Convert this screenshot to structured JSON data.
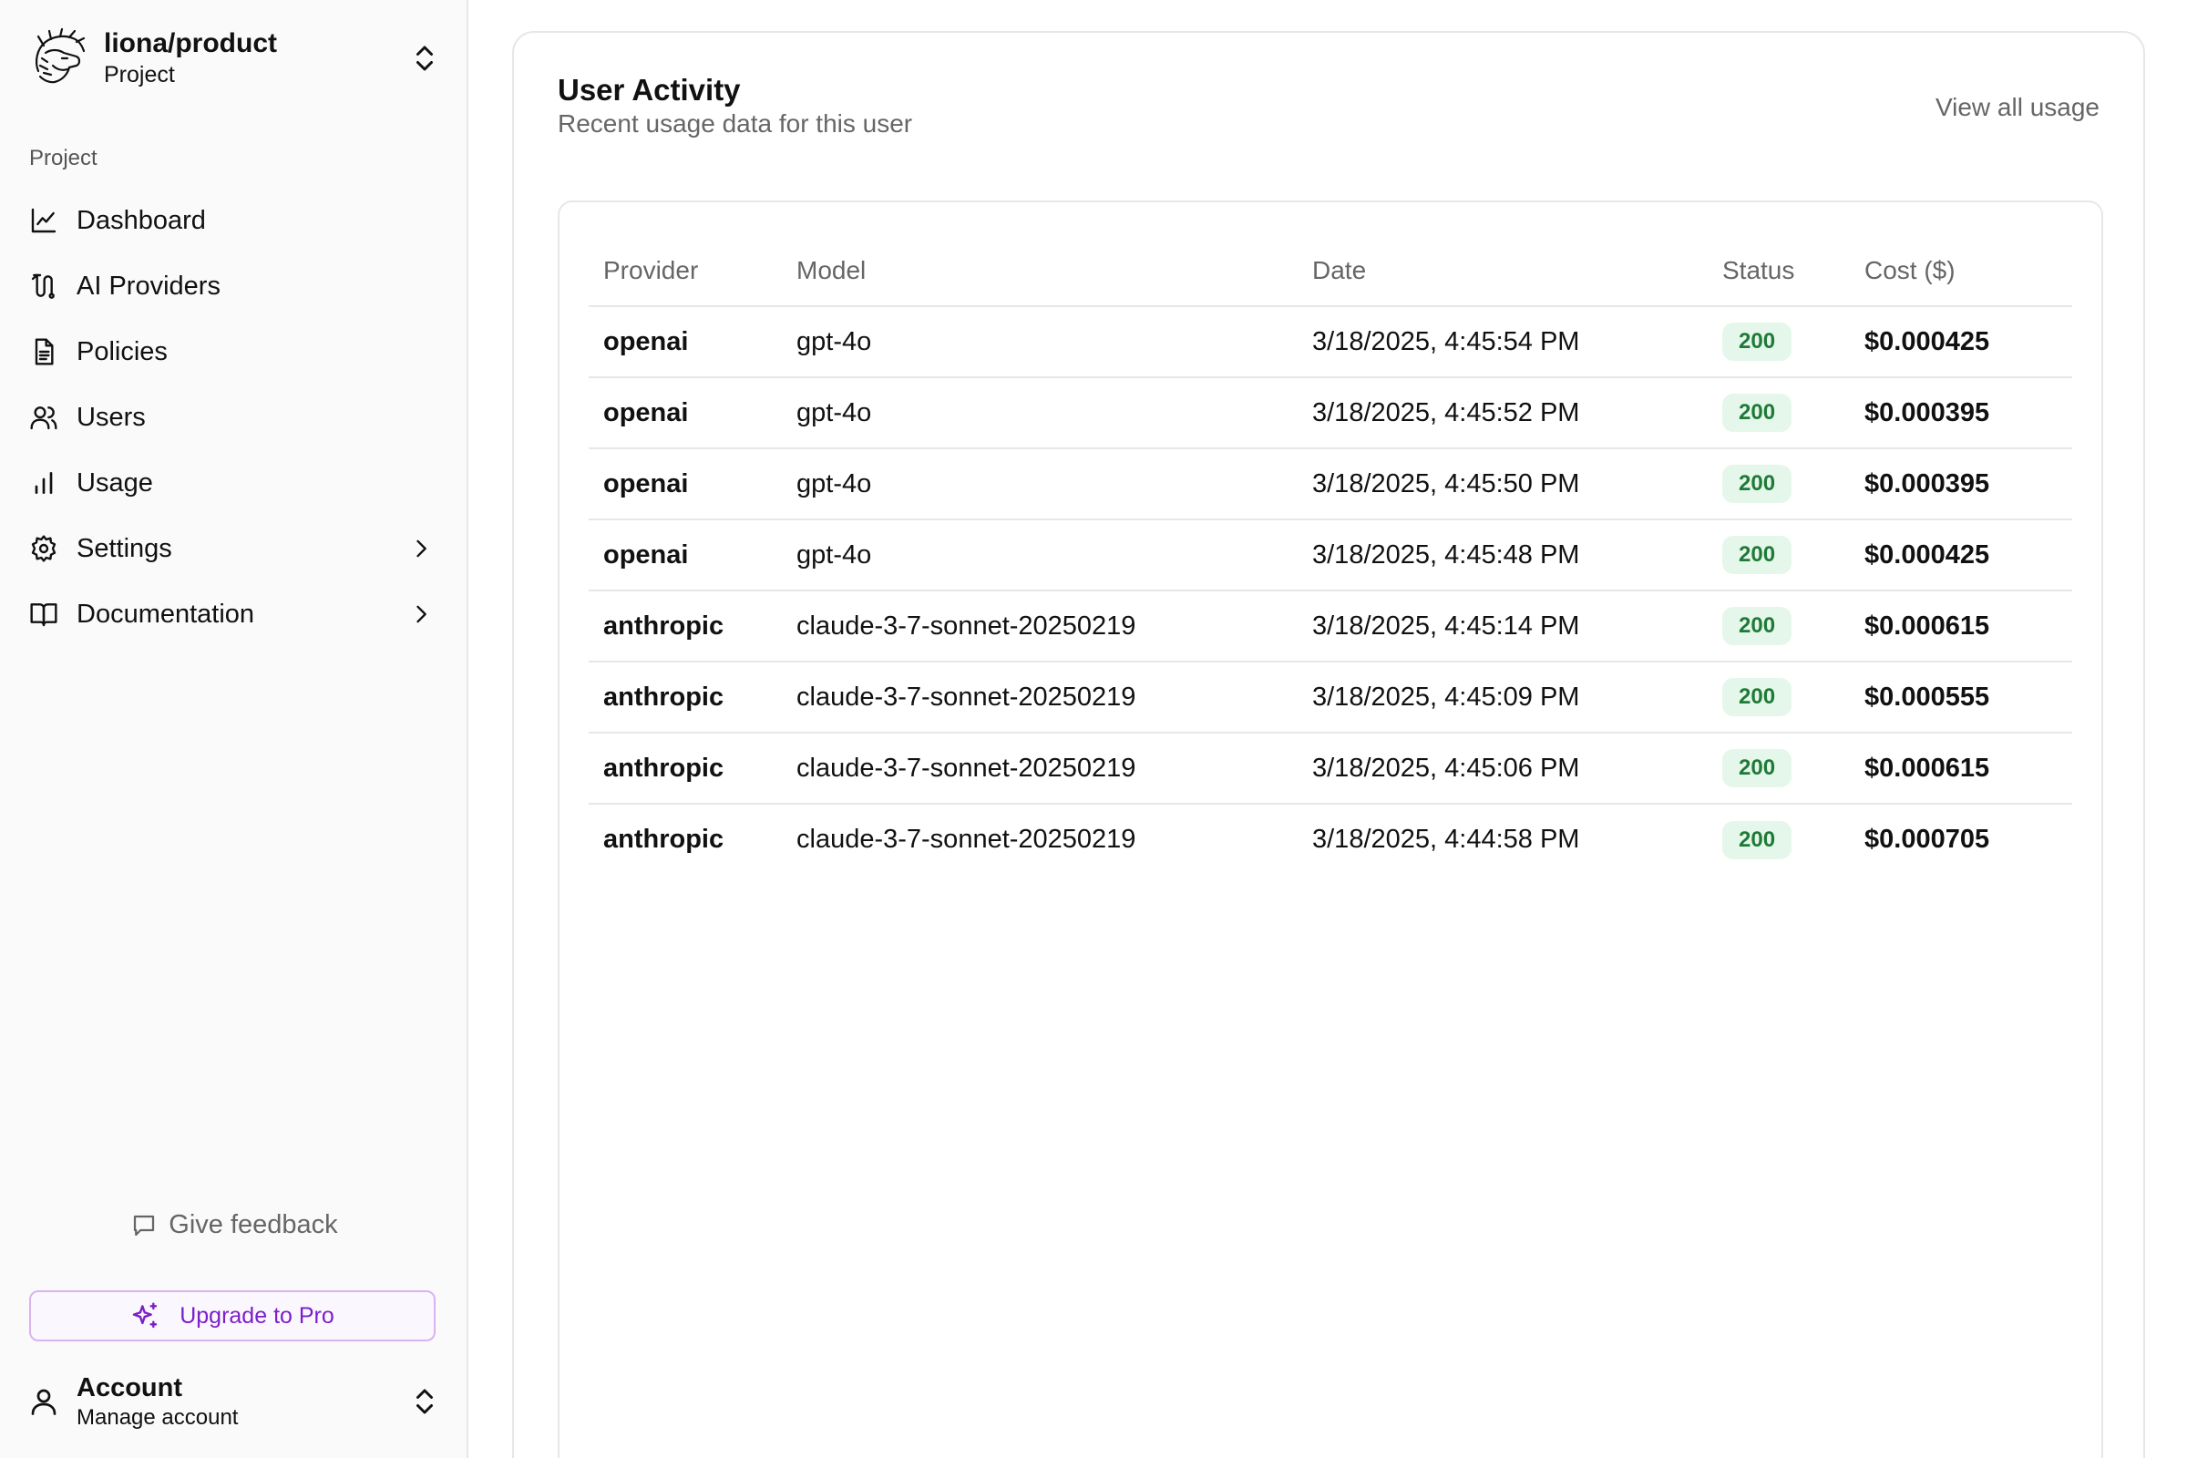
{
  "sidebar": {
    "project": {
      "name": "liona/product",
      "subtitle": "Project"
    },
    "section_label": "Project",
    "items": [
      {
        "label": "Dashboard",
        "icon": "line-chart-icon",
        "has_caret": false
      },
      {
        "label": "AI Providers",
        "icon": "route-icon",
        "has_caret": false
      },
      {
        "label": "Policies",
        "icon": "document-icon",
        "has_caret": false
      },
      {
        "label": "Users",
        "icon": "users-icon",
        "has_caret": false
      },
      {
        "label": "Usage",
        "icon": "bar-chart-icon",
        "has_caret": false
      },
      {
        "label": "Settings",
        "icon": "gear-icon",
        "has_caret": true
      },
      {
        "label": "Documentation",
        "icon": "book-icon",
        "has_caret": true
      }
    ],
    "feedback_label": "Give feedback",
    "upgrade_label": "Upgrade to Pro",
    "account": {
      "title": "Account",
      "subtitle": "Manage account"
    }
  },
  "main": {
    "title": "User Activity",
    "subtitle": "Recent usage data for this user",
    "view_all_label": "View all usage",
    "table": {
      "headers": [
        "Provider",
        "Model",
        "Date",
        "Status",
        "Cost ($)"
      ],
      "rows": [
        {
          "provider": "openai",
          "model": "gpt-4o",
          "date": "3/18/2025, 4:45:54 PM",
          "status": "200",
          "cost": "$0.000425"
        },
        {
          "provider": "openai",
          "model": "gpt-4o",
          "date": "3/18/2025, 4:45:52 PM",
          "status": "200",
          "cost": "$0.000395"
        },
        {
          "provider": "openai",
          "model": "gpt-4o",
          "date": "3/18/2025, 4:45:50 PM",
          "status": "200",
          "cost": "$0.000395"
        },
        {
          "provider": "openai",
          "model": "gpt-4o",
          "date": "3/18/2025, 4:45:48 PM",
          "status": "200",
          "cost": "$0.000425"
        },
        {
          "provider": "anthropic",
          "model": "claude-3-7-sonnet-20250219",
          "date": "3/18/2025, 4:45:14 PM",
          "status": "200",
          "cost": "$0.000615"
        },
        {
          "provider": "anthropic",
          "model": "claude-3-7-sonnet-20250219",
          "date": "3/18/2025, 4:45:09 PM",
          "status": "200",
          "cost": "$0.000555"
        },
        {
          "provider": "anthropic",
          "model": "claude-3-7-sonnet-20250219",
          "date": "3/18/2025, 4:45:06 PM",
          "status": "200",
          "cost": "$0.000615"
        },
        {
          "provider": "anthropic",
          "model": "claude-3-7-sonnet-20250219",
          "date": "3/18/2025, 4:44:58 PM",
          "status": "200",
          "cost": "$0.000705"
        }
      ]
    }
  },
  "colors": {
    "accent_purple": "#7b1fc9",
    "status_ok_bg": "#e5f7ea",
    "status_ok_text": "#1f7a38",
    "sidebar_bg": "#fafafa",
    "border": "#e7e7e7"
  }
}
